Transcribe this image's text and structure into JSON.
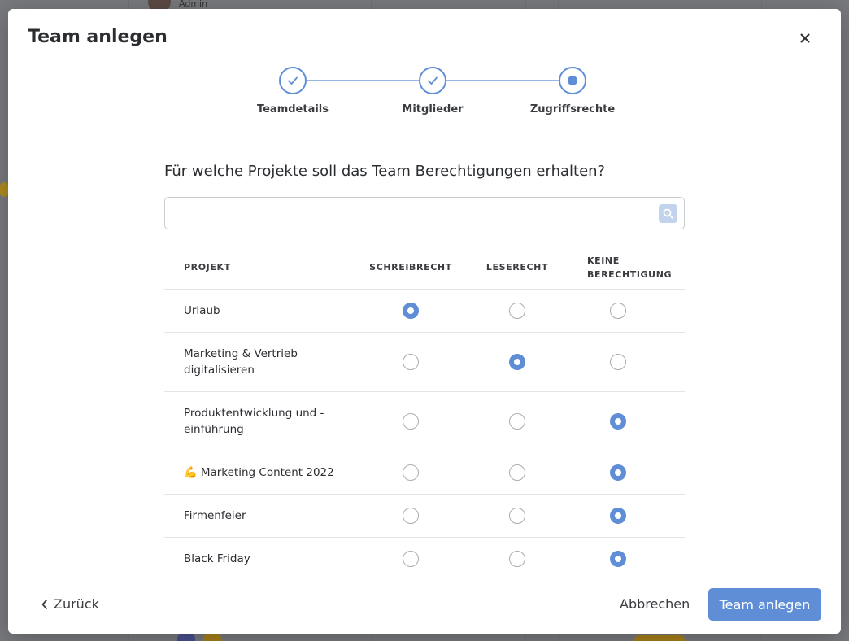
{
  "background": {
    "user_role": "Admin"
  },
  "modal": {
    "title": "Team anlegen",
    "close_icon": "close-icon"
  },
  "stepper": {
    "steps": [
      {
        "label": "Teamdetails",
        "state": "done"
      },
      {
        "label": "Mitglieder",
        "state": "done"
      },
      {
        "label": "Zugriffsrechte",
        "state": "current"
      }
    ]
  },
  "question": "Für welche Projekte soll das Team Berechtigungen erhalten?",
  "search": {
    "value": "",
    "placeholder": "",
    "icon": "search-icon"
  },
  "table": {
    "headers": {
      "project": "PROJEKT",
      "write": "SCHREIBRECHT",
      "read": "LESERECHT",
      "none_line1": "KEINE",
      "none_line2": "BERECHTIGUNG"
    },
    "rows": [
      {
        "name": "Urlaub",
        "emoji": "",
        "selected": "write"
      },
      {
        "name": "Marketing & Vertrieb digitalisieren",
        "emoji": "",
        "selected": "read"
      },
      {
        "name": "Produktentwicklung und -einführung",
        "emoji": "",
        "selected": "none"
      },
      {
        "name": "Marketing Content 2022",
        "emoji": "💪",
        "selected": "none"
      },
      {
        "name": "Firmenfeier",
        "emoji": "",
        "selected": "none"
      },
      {
        "name": "Black Friday",
        "emoji": "",
        "selected": "none"
      }
    ]
  },
  "footer": {
    "back_label": "Zurück",
    "cancel_label": "Abbrechen",
    "submit_label": "Team anlegen"
  },
  "colors": {
    "accent": "#5f8ed6",
    "accent_light": "#c2d3ee"
  }
}
